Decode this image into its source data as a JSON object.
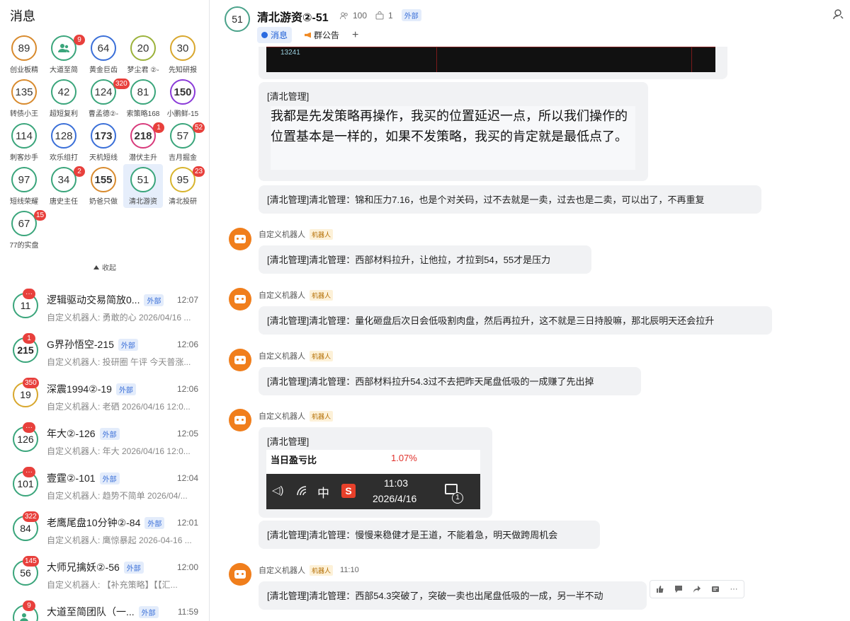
{
  "sidebar": {
    "title": "消息",
    "collapse_label": "收起",
    "groups": [
      {
        "num": "89",
        "label": "创业板精",
        "color": "#d88a2d",
        "badge": ""
      },
      {
        "num": "",
        "label": "大道至简",
        "color": "#3aa57b",
        "badge": "9",
        "icon": "group"
      },
      {
        "num": "64",
        "label": "黄金巨齿",
        "color": "#3a6fd8",
        "badge": ""
      },
      {
        "num": "20",
        "label": "梦尘君 ②-",
        "color": "#9bb23a",
        "badge": ""
      },
      {
        "num": "30",
        "label": "先知研报",
        "color": "#d8a72d",
        "badge": ""
      },
      {
        "num": "135",
        "label": "转债小王",
        "color": "#d88a2d",
        "badge": ""
      },
      {
        "num": "42",
        "label": "超短复利",
        "color": "#3aa57b",
        "badge": ""
      },
      {
        "num": "124",
        "label": "曹孟德②-",
        "color": "#3aa57b",
        "badge": "320"
      },
      {
        "num": "81",
        "label": "索策略168",
        "color": "#3aa57b",
        "badge": ""
      },
      {
        "num": "150",
        "label": "小鹏鲜-15",
        "color": "#8a3ad8",
        "badge": "",
        "bold": true
      },
      {
        "num": "114",
        "label": "刺客炒手",
        "color": "#3aa57b",
        "badge": ""
      },
      {
        "num": "128",
        "label": "欢乐组打",
        "color": "#3a6fd8",
        "badge": ""
      },
      {
        "num": "173",
        "label": "天机短线",
        "color": "#3a6fd8",
        "badge": "",
        "bold": true
      },
      {
        "num": "218",
        "label": "潜伏主升",
        "color": "#d83a7b",
        "badge": "1",
        "bold": true
      },
      {
        "num": "57",
        "label": "吉月掘金",
        "color": "#3aa57b",
        "badge": "52"
      },
      {
        "num": "97",
        "label": "短线荣耀",
        "color": "#3aa57b",
        "badge": ""
      },
      {
        "num": "34",
        "label": "唐史主任",
        "color": "#3aa57b",
        "badge": "2"
      },
      {
        "num": "155",
        "label": "奶爸只做",
        "color": "#d88a2d",
        "badge": "",
        "bold": true
      },
      {
        "num": "51",
        "label": "清北游资",
        "color": "#3aa57b",
        "badge": "",
        "selected": true
      },
      {
        "num": "95",
        "label": "清北投研",
        "color": "#d8b42d",
        "badge": "23"
      },
      {
        "num": "67",
        "label": "77的实盘",
        "color": "#3aa57b",
        "badge": "15"
      }
    ],
    "conversations": [
      {
        "num": "11",
        "badge": "···",
        "name": "逻辑驱动交易简放0...",
        "tag": "外部",
        "time": "12:07",
        "preview": "自定义机器人: 勇敢的心 2026/04/16 ...",
        "color": "#3aa57b"
      },
      {
        "num": "215",
        "badge": "1",
        "name": "G界孙悟空-215",
        "tag": "外部",
        "time": "12:06",
        "preview": "自定义机器人: 投研圈 午评 今天普涨...",
        "color": "#3aa57b",
        "bold": true
      },
      {
        "num": "19",
        "badge": "350",
        "name": "深震1994②-19",
        "tag": "外部",
        "time": "12:06",
        "preview": "自定义机器人: 老硒 2026/04/16 12:0...",
        "color": "#d8a72d"
      },
      {
        "num": "126",
        "badge": "···",
        "name": "年大②-126",
        "tag": "外部",
        "time": "12:05",
        "preview": "自定义机器人: 年大 2026/04/16 12:0...",
        "color": "#3aa57b"
      },
      {
        "num": "101",
        "badge": "···",
        "name": "壹霆②-101",
        "tag": "外部",
        "time": "12:04",
        "preview": "自定义机器人: 趋势不简单 2026/04/...",
        "color": "#3aa57b"
      },
      {
        "num": "84",
        "badge": "322",
        "name": "老鹰尾盘10分钟②-84",
        "tag": "外部",
        "time": "12:01",
        "preview": "自定义机器人: 鹰惊暴起 2026-04-16 ...",
        "color": "#3aa57b"
      },
      {
        "num": "56",
        "badge": "145",
        "name": "大师兄擒妖②-56",
        "tag": "外部",
        "time": "12:00",
        "preview": "自定义机器人: 【补充策略】【【汇...",
        "color": "#3aa57b"
      },
      {
        "num": "",
        "badge": "9",
        "name": "大道至简团队（一...",
        "tag": "外部",
        "time": "11:59",
        "preview": "",
        "color": "#3aa57b"
      }
    ]
  },
  "chat": {
    "avatar_num": "51",
    "title": "清北游资②-51",
    "members": "100",
    "admins": "1",
    "ext_tag": "外部",
    "tabs": [
      {
        "label": "消息",
        "active": true
      },
      {
        "label": "群公告",
        "active": false
      }
    ],
    "add_tab": "+",
    "img_number": "13241",
    "messages": {
      "m1_head": "[清北管理]",
      "m1_body": "我都是先发策略再操作，我买的位置延迟一点，所以我们操作的位置基本是一样的，如果不发策略，我买的肯定就是最低点了。",
      "m2": "[清北管理]清北管理：锦和压力7.16，也是个对关码，过不去就是一卖，过去也是二卖，可以出了，不再重复",
      "sender": "自定义机器人",
      "robot_tag": "机器人",
      "m3": "[清北管理]清北管理：西部材料拉升，让他拉，才拉到54，55才是压力",
      "m4": "[清北管理]清北管理：量化砸盘后次日会低吸割肉盘，然后再拉升，这不就是三日持股嘛，那北辰明天还会拉升",
      "m5": "[清北管理]清北管理：西部材料拉升54.3过不去把昨天尾盘低吸的一成赚了先出掉",
      "m6_head": "[清北管理]",
      "m6_profit_label": "当日盈亏比",
      "m6_profit_value": "1.07%",
      "m6_taskbar_cn": "中",
      "m6_time": "11:03",
      "m6_date": "2026/4/16",
      "m6_notif": "1",
      "m7": "[清北管理]清北管理：慢慢来稳健才是王道，不能着急，明天做跨周机会",
      "m8_time": "11:10",
      "m8": "[清北管理]清北管理：西部54.3突破了，突破一卖也出尾盘低吸的一成，另一半不动"
    }
  },
  "colors": {
    "accent": "#2a6ae0",
    "badge": "#e8403c",
    "robot": "#f07e1c",
    "red_value": "#e0302a"
  }
}
